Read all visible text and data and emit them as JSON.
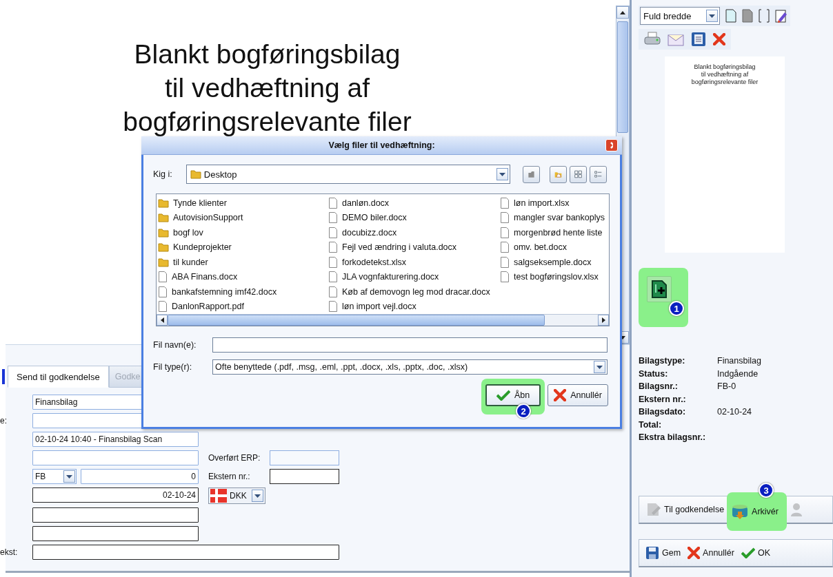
{
  "document": {
    "lines": [
      "Blankt bogføringsbilag",
      "til vedhæftning af",
      "bogføringsrelevante filer"
    ]
  },
  "form": {
    "tabs": [
      {
        "label": "Send til godkendelse",
        "selected": true,
        "disabled": false
      },
      {
        "label": "Godke",
        "selected": false,
        "disabled": true
      }
    ],
    "rows": [
      {
        "field": {
          "value": "Finansbilag",
          "wide": true,
          "readonly": true
        }
      },
      {
        "label": "e:",
        "field": {
          "wide": true,
          "readonly": true
        }
      },
      {
        "field": {
          "value": "02-10-24 10:40 - Finansbilag Scan",
          "wide": false,
          "readonly": true
        }
      },
      {
        "field": {
          "wide": false,
          "readonly": true
        },
        "side": {
          "kind": "field",
          "label": "Overført ERP:",
          "readonly": true
        }
      },
      {
        "field": {
          "kind": "series",
          "prefix": "FB",
          "value": "0",
          "readonly": true
        },
        "side": {
          "kind": "field",
          "label": "Ekstern nr.:",
          "readonly": false
        }
      },
      {
        "field": {
          "value": "02-10-24",
          "align_right": true,
          "wide": false,
          "readonly": false
        },
        "side": {
          "kind": "currency",
          "value": "DKK"
        }
      },
      {
        "field": {
          "wide": false,
          "readonly": false
        }
      },
      {
        "field": {
          "wide": false,
          "readonly": false
        }
      },
      {
        "label": "ekst:",
        "field": {
          "wide": true,
          "readonly": false
        }
      }
    ]
  },
  "side_panel": {
    "zoom_select": {
      "value": "Fuld bredde"
    },
    "thumbnail": {
      "lines": [
        "Blankt bogføringsbilag",
        "til vedhæftning af",
        "bogføringsrelevante filer"
      ]
    },
    "attach_button": {
      "highlighted": true,
      "badge": "1"
    },
    "info": [
      {
        "label": "Bilagstype:",
        "value": "Finansbilag"
      },
      {
        "label": "Status:",
        "value": "Indgående"
      },
      {
        "label": "Bilagsnr.:",
        "value": "FB-0"
      },
      {
        "label": "Ekstern nr.:"
      },
      {
        "label": "Bilagsdato:",
        "value": "02-10-24"
      },
      {
        "label": "Total:"
      },
      {
        "label": "Ekstra bilagsnr.:"
      }
    ],
    "workflow_buttons": [
      {
        "label": "Til godkendelse",
        "highlighted": false,
        "disabled": true
      },
      {
        "label": "Arkivér",
        "highlighted": true,
        "badge": "3",
        "disabled": false
      },
      {
        "highlighted": false,
        "disabled": true
      }
    ],
    "buttons": [
      {
        "label": "Gem"
      },
      {
        "label": "Annullér"
      },
      {
        "label": "OK"
      }
    ]
  },
  "dialog": {
    "title": "Vælg filer til vedhæftning:",
    "look_in": {
      "label": "Kig i:",
      "value": "Desktop"
    },
    "files": [
      {
        "name": "Tynde klienter",
        "kind": "folder"
      },
      {
        "name": "AutovisionSupport",
        "kind": "folder"
      },
      {
        "name": "bogf lov",
        "kind": "folder"
      },
      {
        "name": "Kundeprojekter",
        "kind": "folder"
      },
      {
        "name": "til kunder",
        "kind": "folder"
      },
      {
        "name": "ABA Finans.docx",
        "kind": "file"
      },
      {
        "name": "bankafstemning imf42.docx",
        "kind": "file"
      },
      {
        "name": "DanlonRapport.pdf",
        "kind": "file"
      },
      {
        "name": "danløn.docx",
        "kind": "file"
      },
      {
        "name": "DEMO biler.docx",
        "kind": "file"
      },
      {
        "name": "docubizz.docx",
        "kind": "file"
      },
      {
        "name": "Fejl ved ændring i valuta.docx",
        "kind": "file"
      },
      {
        "name": "forkodetekst.xlsx",
        "kind": "file"
      },
      {
        "name": "JLA vognfakturering.docx",
        "kind": "file"
      },
      {
        "name": "Køb af demovogn leg mod dracar.docx",
        "kind": "file"
      },
      {
        "name": "løn import vejl.docx",
        "kind": "file"
      },
      {
        "name": "løn import.xlsx",
        "kind": "file"
      },
      {
        "name": "mangler svar bankoplys",
        "kind": "file"
      },
      {
        "name": "morgenbrød hente liste",
        "kind": "file"
      },
      {
        "name": "omv. bet.docx",
        "kind": "file"
      },
      {
        "name": "salgseksemple.docx",
        "kind": "file"
      },
      {
        "name": "test bogføringslov.xlsx",
        "kind": "file"
      }
    ],
    "file_name": {
      "label": "Fil navn(e):"
    },
    "file_type": {
      "label": "Fil type(r):",
      "value": "Ofte benyttede (.pdf, .msg, .eml, .ppt, .docx, .xls, .pptx, .doc, .xlsx)"
    },
    "buttons": [
      {
        "label": "Åbn",
        "kind": "ok",
        "highlighted": true,
        "badge": "2"
      },
      {
        "label": "Annullér",
        "kind": "cancel",
        "highlighted": false
      }
    ]
  }
}
